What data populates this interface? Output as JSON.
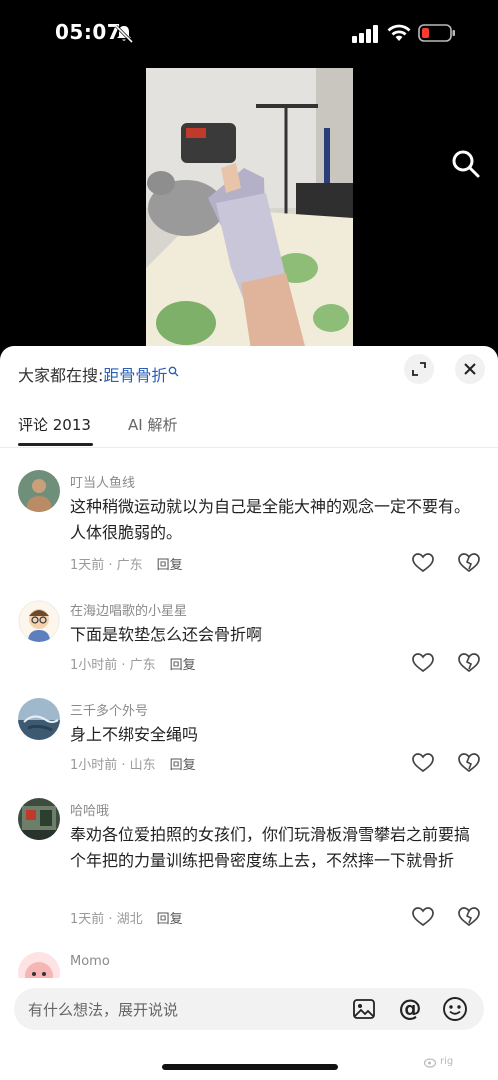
{
  "status_bar": {
    "time": "05:07"
  },
  "sheet": {
    "hot_search_label": "大家都在搜:",
    "hot_search_term": "距骨骨折",
    "tabs": [
      {
        "label": "评论 2013"
      },
      {
        "label": "AI 解析"
      }
    ]
  },
  "comments": [
    {
      "user": "叮当人鱼线",
      "text": "这种稍微运动就以为自己是全能大神的观念一定不要有。人体很脆弱的。",
      "time_location": "1天前 · 广东",
      "reply": "回复"
    },
    {
      "user": "在海边唱歌的小星星",
      "text": "下面是软垫怎么还会骨折啊",
      "time_location": "1小时前 · 广东",
      "reply": "回复"
    },
    {
      "user": "三千多个外号",
      "text": "身上不绑安全绳吗",
      "time_location": "1小时前 · 山东",
      "reply": "回复"
    },
    {
      "user": "哈哈哦",
      "text": "奉劝各位爱拍照的女孩们，你们玩滑板滑雪攀岩之前要搞个年把的力量训练把骨密度练上去，不然摔一下就骨折",
      "time_location": "1天前 · 湖北",
      "reply": "回复"
    },
    {
      "user": "Momo",
      "text": "",
      "time_location": "",
      "reply": ""
    }
  ],
  "input": {
    "placeholder": "有什么想法，展开说说"
  },
  "watermark": "rig"
}
